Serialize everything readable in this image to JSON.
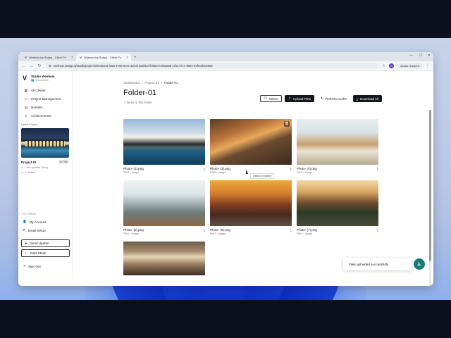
{
  "browser": {
    "tabs": [
      {
        "label": "Weshow by Snapp - Client Po",
        "favicon": "weshow-logo"
      },
      {
        "label": "Weshow by Snapp - Client Po",
        "favicon": "weshow-logo"
      }
    ],
    "new_tab": "+",
    "url": "weshow.snapp.ai/studio/project/29e32ac5-f25a-4765-9c9c-337212a6f157/folder/ec962a68-ccfa-471e-9694-42fe0d4c6553",
    "action_required": "Action required",
    "profile_initial": "S"
  },
  "sidebar": {
    "brand_name": "Studio Weshow",
    "members": "3 members",
    "nav": [
      {
        "label": "All Clients",
        "icon": "grid-icon"
      },
      {
        "label": "Project Management",
        "icon": "folder-icon"
      },
      {
        "label": "Notesks",
        "icon": "note-icon"
      },
      {
        "label": "Achievements",
        "icon": "trophy-icon"
      }
    ],
    "latest_label": "Latest Project",
    "project_name": "Project-01",
    "project_badge": "ACTIVE",
    "project_updated": "Last updated Today",
    "project_folders": "1 folders",
    "settings_label": "SETTINGS",
    "my_account": "My Account",
    "email_setup": "Email Setup",
    "send_update": "Send Update",
    "dark_mode": "Dark Mode",
    "sign_out": "Sign Out"
  },
  "main": {
    "breadcrumb": [
      "Dashboard",
      "Project-01",
      "Folder-01"
    ],
    "title": "Folder-01",
    "count": "7 items in this folder",
    "actions": {
      "select": "Select",
      "upload": "Upload Files",
      "refresh": "Refresh Cache",
      "download_all": "Download All"
    },
    "files": [
      {
        "name": "Photo- (2).png",
        "type": "PNG • Image"
      },
      {
        "name": "Photo- (3).png",
        "type": "PNG • Image"
      },
      {
        "name": "Photo- (4).png",
        "type": "PNG • Image"
      },
      {
        "name": "Photo- (5).png",
        "type": "PNG • Image"
      },
      {
        "name": "Photo- (6).png",
        "type": "PNG • Image"
      },
      {
        "name": "Photo- (7).png",
        "type": "PNG • Image"
      },
      {
        "name": "",
        "type": ""
      }
    ],
    "tooltip": "Click to rename"
  },
  "toast": {
    "message": "Files uploaded successfully"
  }
}
